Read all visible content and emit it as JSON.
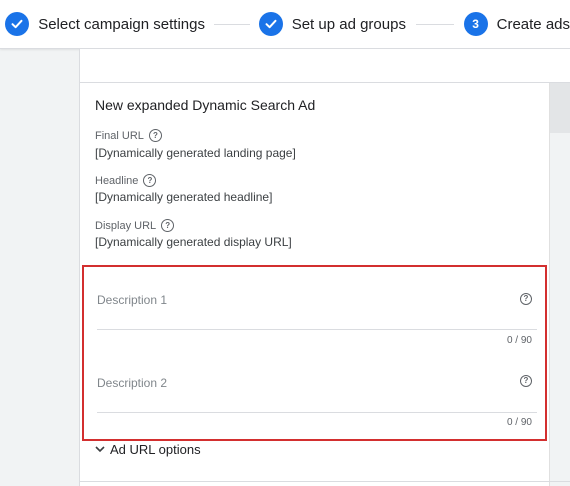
{
  "stepper": {
    "steps": [
      {
        "label": "Select campaign settings",
        "state": "done"
      },
      {
        "label": "Set up ad groups",
        "state": "done"
      },
      {
        "number": "3",
        "label": "Create ads",
        "state": "current"
      }
    ]
  },
  "ad": {
    "title": "New expanded Dynamic Search Ad",
    "fields": [
      {
        "label": "Final URL",
        "value": "[Dynamically generated landing page]"
      },
      {
        "label": "Headline",
        "value": "[Dynamically generated headline]"
      },
      {
        "label": "Display URL",
        "value": "[Dynamically generated display URL]"
      }
    ],
    "help_glyph": "?"
  },
  "descriptions": [
    {
      "placeholder": "Description 1",
      "counter": "0 / 90"
    },
    {
      "placeholder": "Description 2",
      "counter": "0 / 90"
    }
  ],
  "url_options": {
    "label": "Ad URL options"
  },
  "colors": {
    "accent": "#1a73e8",
    "highlight": "#d32f2f"
  },
  "icons": {
    "done": "check-icon",
    "help": "help-circle-icon",
    "expand": "chevron-down-icon"
  }
}
